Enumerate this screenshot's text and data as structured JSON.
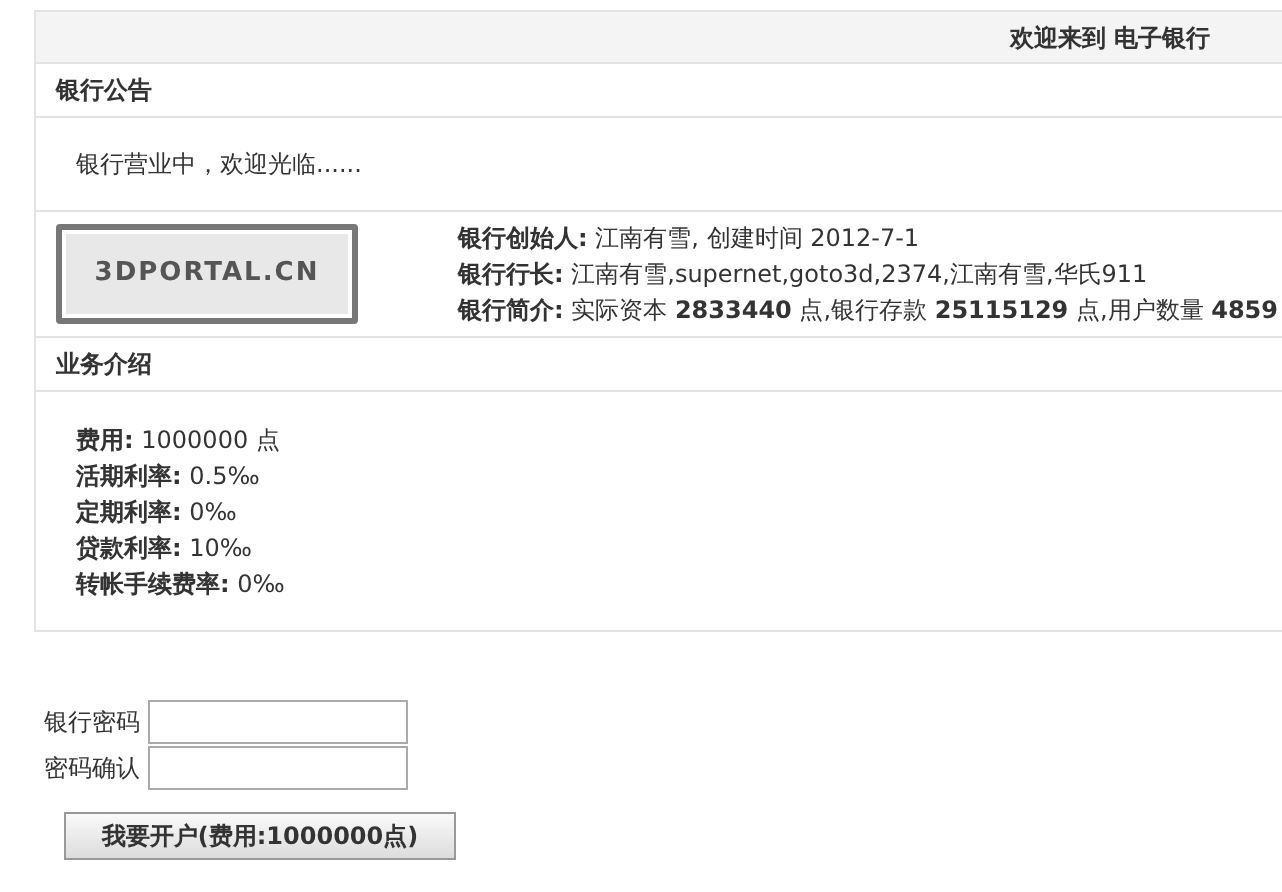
{
  "header": {
    "title": "欢迎来到 电子银行"
  },
  "notice": {
    "heading": "银行公告",
    "text": "银行营业中，欢迎光临......"
  },
  "bank_info": {
    "logo_text": "3DPORTAL.CN",
    "lines": [
      "**银行创始人:** 江南有雪, 创建时间 2012-7-1",
      "**银行行长:** 江南有雪,supernet,goto3d,2374,江南有雪,华氏911",
      "**银行简介:** 实际资本 **2833440** 点,银行存款 **25115129** 点,用户数量 **4859**"
    ]
  },
  "business": {
    "heading": "业务介绍",
    "items": [
      {
        "label": "费用:",
        "value": "1000000 点"
      },
      {
        "label": "活期利率:",
        "value": "0.5‰"
      },
      {
        "label": "定期利率:",
        "value": "0‰"
      },
      {
        "label": "贷款利率:",
        "value": "10‰"
      },
      {
        "label": "转帐手续费率:",
        "value": "0‰"
      }
    ]
  },
  "form": {
    "fields": [
      {
        "label": "银行密码"
      },
      {
        "label": "密码确认"
      }
    ],
    "submit": "我要开户(费用:1000000点)"
  }
}
